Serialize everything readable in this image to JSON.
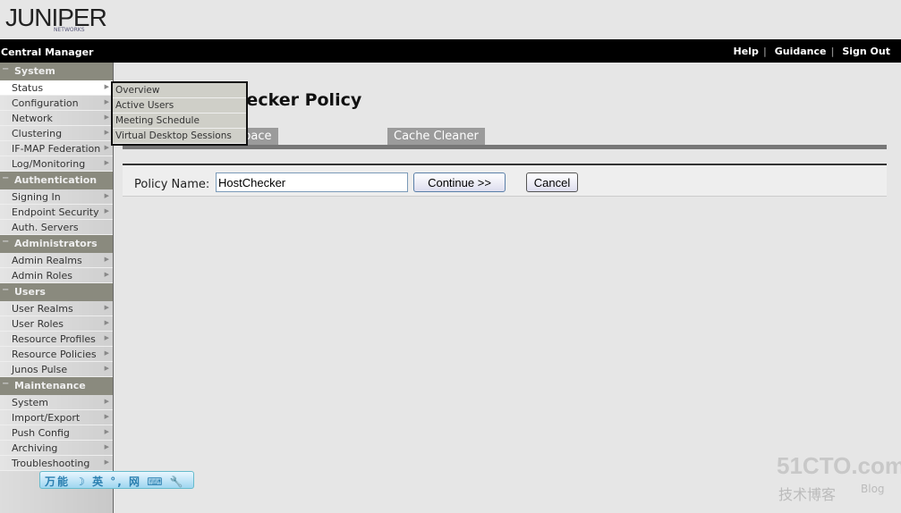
{
  "logo": {
    "brand": "JUNIPER",
    "sub": "NETWORKS"
  },
  "header": {
    "title": "Central Manager",
    "links": [
      "Help",
      "Guidance",
      "Sign Out"
    ]
  },
  "sidebar": [
    {
      "section": "System",
      "items": [
        "Status",
        "Configuration",
        "Network",
        "Clustering",
        "IF-MAP Federation",
        "Log/Monitoring"
      ]
    },
    {
      "section": "Authentication",
      "items": [
        "Signing In",
        "Endpoint Security",
        "Auth. Servers"
      ]
    },
    {
      "section": "Administrators",
      "items": [
        "Admin Realms",
        "Admin Roles"
      ]
    },
    {
      "section": "Users",
      "items": [
        "User Realms",
        "User Roles",
        "Resource Profiles",
        "Resource Policies",
        "Junos Pulse"
      ]
    },
    {
      "section": "Maintenance",
      "items": [
        "System",
        "Import/Export",
        "Push Config",
        "Archiving",
        "Troubleshooting"
      ]
    }
  ],
  "flyout": [
    "Overview",
    "Active Users",
    "Meeting Schedule",
    "Virtual Desktop Sessions"
  ],
  "page": {
    "title": "Host Checker Policy",
    "tabs": [
      "Secure Virtual Workspace",
      "Cache Cleaner"
    ]
  },
  "form": {
    "label": "Policy Name:",
    "value": "HostChecker",
    "continue": "Continue >>",
    "cancel": "Cancel"
  },
  "ime": {
    "text": "万能 ☽ 英 °, 网 ⌨ 🔧"
  },
  "watermark": {
    "site": "51CTO.com",
    "cn": "技术博客",
    "blog": "Blog"
  }
}
